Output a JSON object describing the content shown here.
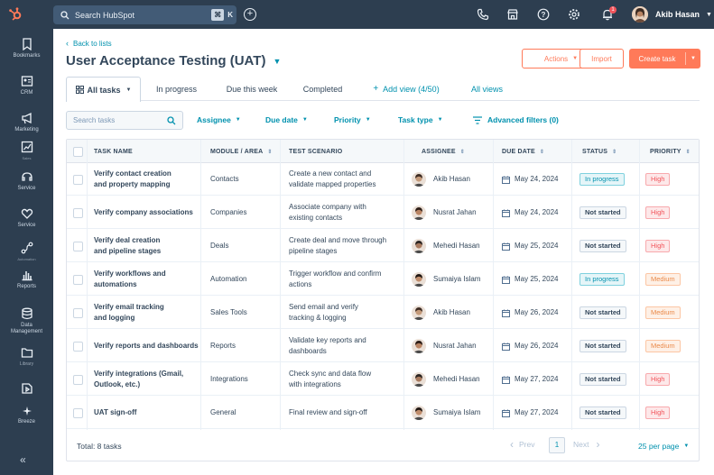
{
  "topbar": {
    "search_placeholder": "Search HubSpot",
    "shortcut_mod": "⌘",
    "shortcut_key": "K",
    "notification_count": "1",
    "user_name": "Akib Hasan"
  },
  "sidebar": {
    "items": [
      {
        "label": "Bookmarks"
      },
      {
        "label": "CRM"
      },
      {
        "label": "Marketing"
      },
      {
        "label": "Sales"
      },
      {
        "label": "Service"
      },
      {
        "label": "Service"
      },
      {
        "label": "Automation"
      },
      {
        "label": "Reports"
      },
      {
        "label": "Data Management"
      },
      {
        "label": "Library"
      },
      {
        "label": "Breeze"
      }
    ],
    "collapse": "«"
  },
  "page": {
    "back_link": "Back to lists",
    "title": "User Acceptance Testing (UAT)",
    "actions_label": "Actions",
    "import_label": "Import",
    "create_label": "Create task"
  },
  "tabs": {
    "all": "All tasks",
    "in_progress": "In progress",
    "due_week": "Due this week",
    "completed": "Completed",
    "add_view": "Add view (4/50)",
    "all_views": "All views"
  },
  "filters": {
    "search_placeholder": "Search tasks",
    "assignee": "Assignee",
    "due_date": "Due date",
    "priority": "Priority",
    "task_type": "Task type",
    "advanced": "Advanced filters (0)"
  },
  "table": {
    "headers": {
      "task": "TASK NAME",
      "module": "MODULE / AREA",
      "scenario": "TEST SCENARIO",
      "assignee": "ASSIGNEE",
      "due": "DUE DATE",
      "status": "STATUS",
      "priority": "PRIORITY"
    },
    "rows": [
      {
        "task1": "Verify contact creation",
        "task2": "and property mapping",
        "module": "Contacts",
        "sc1": "Create a new contact and",
        "sc2": "validate mapped properties",
        "assignee": "Akib Hasan",
        "due": "May 24, 2024",
        "status": "In progress",
        "priority": "High"
      },
      {
        "task1": "Verify company associations",
        "task2": "",
        "module": "Companies",
        "sc1": "Associate company with",
        "sc2": "existing contacts",
        "assignee": "Nusrat Jahan",
        "due": "May 24, 2024",
        "status": "Not started",
        "priority": "High"
      },
      {
        "task1": "Verify deal creation",
        "task2": "and pipeline stages",
        "module": "Deals",
        "sc1": "Create deal and move through",
        "sc2": "pipeline stages",
        "assignee": "Mehedi Hasan",
        "due": "May 25, 2024",
        "status": "Not started",
        "priority": "High"
      },
      {
        "task1": "Verify workflows and",
        "task2": "automations",
        "module": "Automation",
        "sc1": "Trigger workflow and confirm",
        "sc2": "actions",
        "assignee": "Sumaiya Islam",
        "due": "May 25, 2024",
        "status": "In progress",
        "priority": "Medium"
      },
      {
        "task1": "Verify email tracking",
        "task2": "and logging",
        "module": "Sales Tools",
        "sc1": "Send email and verify",
        "sc2": "tracking & logging",
        "assignee": "Akib Hasan",
        "due": "May 26, 2024",
        "status": "Not started",
        "priority": "Medium"
      },
      {
        "task1": "Verify reports and dashboards",
        "task2": "",
        "module": "Reports",
        "sc1": "Validate key reports and",
        "sc2": "dashboards",
        "assignee": "Nusrat Jahan",
        "due": "May 26, 2024",
        "status": "Not started",
        "priority": "Medium"
      },
      {
        "task1": "Verify integrations (Gmail,",
        "task2": "Outlook, etc.)",
        "module": "Integrations",
        "sc1": "Check sync and data flow",
        "sc2": "with integrations",
        "assignee": "Mehedi Hasan",
        "due": "May 27, 2024",
        "status": "Not started",
        "priority": "High"
      },
      {
        "task1": "UAT sign-off",
        "task2": "",
        "module": "General",
        "sc1": "Final review and sign-off",
        "sc2": "",
        "assignee": "Sumaiya Islam",
        "due": "May 27, 2024",
        "status": "Not started",
        "priority": "High"
      }
    ],
    "total": "Total: 8 tasks",
    "prev": "Prev",
    "page": "1",
    "next": "Next",
    "per_page": "25 per page"
  },
  "colors": {
    "accent": "#ff7a59",
    "link": "#0091ae",
    "nav": "#2d3e50"
  }
}
